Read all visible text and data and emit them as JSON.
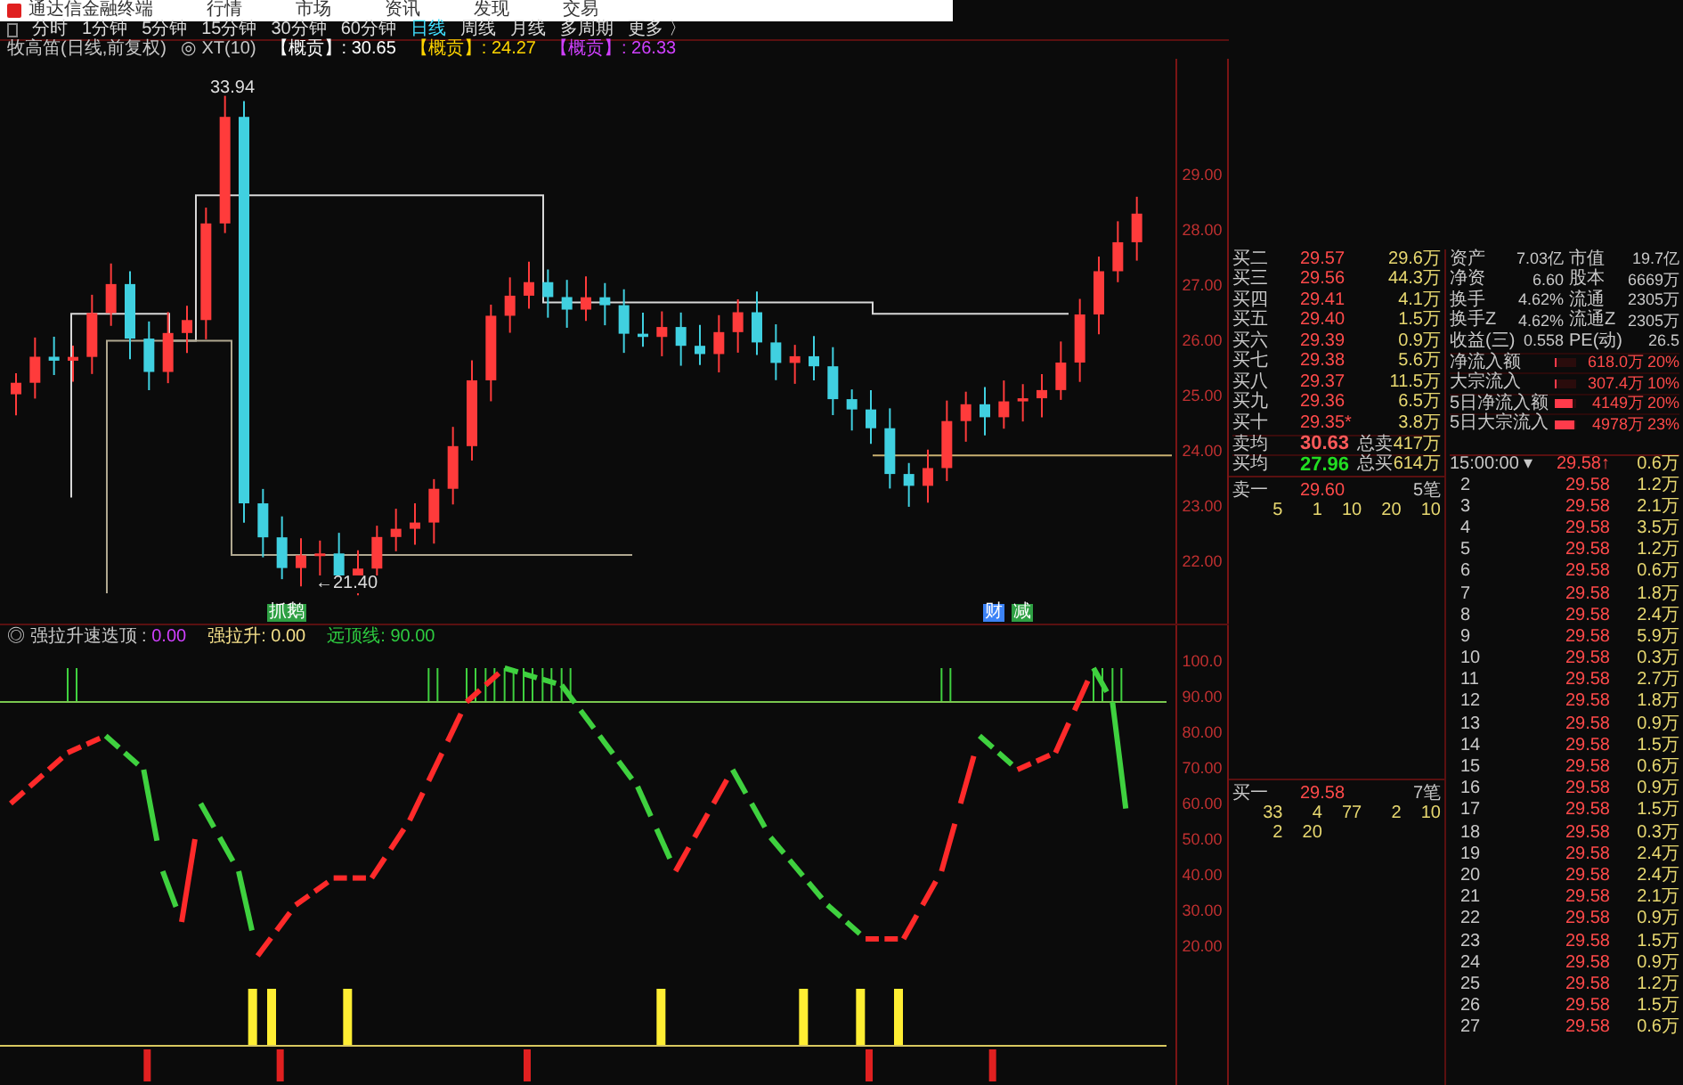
{
  "window": {
    "title": "通达信金融终端",
    "menus": [
      "行情",
      "市场",
      "资讯",
      "发现",
      "交易"
    ]
  },
  "periods": [
    {
      "label": "分时",
      "selected": false
    },
    {
      "label": "1分钟",
      "selected": false
    },
    {
      "label": "5分钟",
      "selected": false
    },
    {
      "label": "15分钟",
      "selected": false
    },
    {
      "label": "30分钟",
      "selected": false
    },
    {
      "label": "60分钟",
      "selected": false
    },
    {
      "label": "日线",
      "selected": true
    },
    {
      "label": "周线",
      "selected": false
    },
    {
      "label": "月线",
      "selected": false
    },
    {
      "label": "多周期",
      "selected": false
    },
    {
      "label": "更多 〉",
      "selected": false
    }
  ],
  "info": {
    "name": "牧高笛(日线,前复权)",
    "indicator": "◎ XT(10)",
    "values": [
      {
        "label": "【概贡】",
        "value": ": 30.65",
        "color": "#ffffff"
      },
      {
        "label": "【概贡】",
        "value": ": 24.27",
        "color": "#ffd400"
      },
      {
        "label": "【概贡】",
        "value": ": 26.33",
        "color": "#d040ff"
      }
    ]
  },
  "main_chart": {
    "peak_label": "33.94",
    "low_label": "←21.40",
    "axis_labels": [
      "29.00",
      "28.00",
      "27.00",
      "26.00",
      "25.00",
      "24.00",
      "23.00",
      "22.00"
    ],
    "signals": [
      {
        "text": "抓鹅",
        "color": "#2ea043"
      },
      {
        "text": "财",
        "color": "#3b82f6"
      },
      {
        "text": "减",
        "color": "#2ea043"
      }
    ]
  },
  "indicator": {
    "title": "◎ 强拉升速迭顶 :",
    "title_value": "0.00",
    "fields": [
      {
        "label": "强拉升:",
        "value": "0.00",
        "color": "#f5e08a"
      },
      {
        "label": "远顶线:",
        "value": "90.00",
        "color": "#2ecc40"
      }
    ],
    "axis_labels": [
      "100.0",
      "90.00",
      "80.00",
      "70.00",
      "60.00",
      "50.00",
      "40.00",
      "30.00",
      "20.00"
    ]
  },
  "order_book": [
    {
      "label": "买二",
      "price": "29.57",
      "volume": "29.6万"
    },
    {
      "label": "买三",
      "price": "29.56",
      "volume": "44.3万"
    },
    {
      "label": "买四",
      "price": "29.41",
      "volume": "4.1万"
    },
    {
      "label": "买五",
      "price": "29.40",
      "volume": "1.5万"
    },
    {
      "label": "买六",
      "price": "29.39",
      "volume": "0.9万"
    },
    {
      "label": "买七",
      "price": "29.38",
      "volume": "5.6万"
    },
    {
      "label": "买八",
      "price": "29.37",
      "volume": "11.5万"
    },
    {
      "label": "买九",
      "price": "29.36",
      "volume": "6.5万"
    },
    {
      "label": "买十",
      "price": "29.35*",
      "volume": "3.8万"
    }
  ],
  "averages": [
    {
      "label": "卖均",
      "price": "30.63",
      "total_label": "总卖",
      "total": "417万",
      "color": "#ff5a5a"
    },
    {
      "label": "买均",
      "price": "27.96",
      "total_label": "总买",
      "total": "614万",
      "color": "#22dd22"
    }
  ],
  "stats": [
    {
      "label": "资产",
      "value": "7.03亿",
      "label2": "市值",
      "value2": "19.7亿"
    },
    {
      "label": "净资",
      "value": "6.60",
      "label2": "股本",
      "value2": "6669万"
    },
    {
      "label": "换手",
      "value": "4.62%",
      "label2": "流通",
      "value2": "2305万"
    },
    {
      "label": "换手Z",
      "value": "4.62%",
      "label2": "流通Z",
      "value2": "2305万"
    },
    {
      "label": "收益(三)",
      "value": "0.558",
      "label2": "PE(动)",
      "value2": "26.5"
    }
  ],
  "flows": [
    {
      "label": "净流入额",
      "value": "618.0万",
      "pct": "20%",
      "level": 0.05
    },
    {
      "label": "大宗流入",
      "value": "307.4万",
      "pct": "10%",
      "level": 0.05
    },
    {
      "label": "5日净流入额",
      "value": "4149万",
      "pct": "20%",
      "level": 0.8
    },
    {
      "label": "5日大宗流入",
      "value": "4978万",
      "pct": "23%",
      "level": 0.9
    }
  ],
  "queues": [
    {
      "label": "卖一",
      "price": "29.60",
      "count": "5笔",
      "orders": [
        "5",
        "1",
        "10",
        "20",
        "10"
      ]
    },
    {
      "label": "买一",
      "price": "29.58",
      "count": "7笔",
      "orders": [
        "33",
        "4",
        "77",
        "2",
        "10",
        "2",
        "20"
      ]
    }
  ],
  "ticks_header": {
    "time": "15:00:00 ▾",
    "price": "29.58↑",
    "volume": "0.6万"
  },
  "ticks": [
    {
      "n": "2",
      "price": "29.58",
      "volume": "1.2万"
    },
    {
      "n": "3",
      "price": "29.58",
      "volume": "2.1万"
    },
    {
      "n": "4",
      "price": "29.58",
      "volume": "3.5万"
    },
    {
      "n": "5",
      "price": "29.58",
      "volume": "1.2万"
    },
    {
      "n": "6",
      "price": "29.58",
      "volume": "0.6万"
    },
    {
      "n": "7",
      "price": "29.58",
      "volume": "1.8万"
    },
    {
      "n": "8",
      "price": "29.58",
      "volume": "2.4万"
    },
    {
      "n": "9",
      "price": "29.58",
      "volume": "5.9万"
    },
    {
      "n": "10",
      "price": "29.58",
      "volume": "0.3万"
    },
    {
      "n": "11",
      "price": "29.58",
      "volume": "2.7万"
    },
    {
      "n": "12",
      "price": "29.58",
      "volume": "1.8万"
    },
    {
      "n": "13",
      "price": "29.58",
      "volume": "0.9万"
    },
    {
      "n": "14",
      "price": "29.58",
      "volume": "1.5万"
    },
    {
      "n": "15",
      "price": "29.58",
      "volume": "0.6万"
    },
    {
      "n": "16",
      "price": "29.58",
      "volume": "0.9万"
    },
    {
      "n": "17",
      "price": "29.58",
      "volume": "1.5万"
    },
    {
      "n": "18",
      "price": "29.58",
      "volume": "0.3万"
    },
    {
      "n": "19",
      "price": "29.58",
      "volume": "2.4万"
    },
    {
      "n": "20",
      "price": "29.58",
      "volume": "2.4万"
    },
    {
      "n": "21",
      "price": "29.58",
      "volume": "2.1万"
    },
    {
      "n": "22",
      "price": "29.58",
      "volume": "0.9万"
    },
    {
      "n": "23",
      "price": "29.58",
      "volume": "1.5万"
    },
    {
      "n": "24",
      "price": "29.58",
      "volume": "0.9万"
    },
    {
      "n": "25",
      "price": "29.58",
      "volume": "1.2万"
    },
    {
      "n": "26",
      "price": "29.58",
      "volume": "1.5万"
    },
    {
      "n": "27",
      "price": "29.58",
      "volume": "0.6万"
    }
  ]
}
